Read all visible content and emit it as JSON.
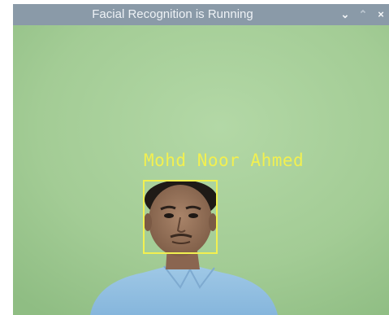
{
  "window": {
    "title": "Facial Recognition is Running",
    "controls": {
      "minimize_glyph": "⌄",
      "maximize_glyph": "⌃",
      "close_glyph": "×"
    }
  },
  "detection": {
    "name": "Mohd Noor Ahmed"
  },
  "colors": {
    "titlebar": "#8a9aa8",
    "wall": "#a8cf9a",
    "overlay": "#f2f050"
  }
}
